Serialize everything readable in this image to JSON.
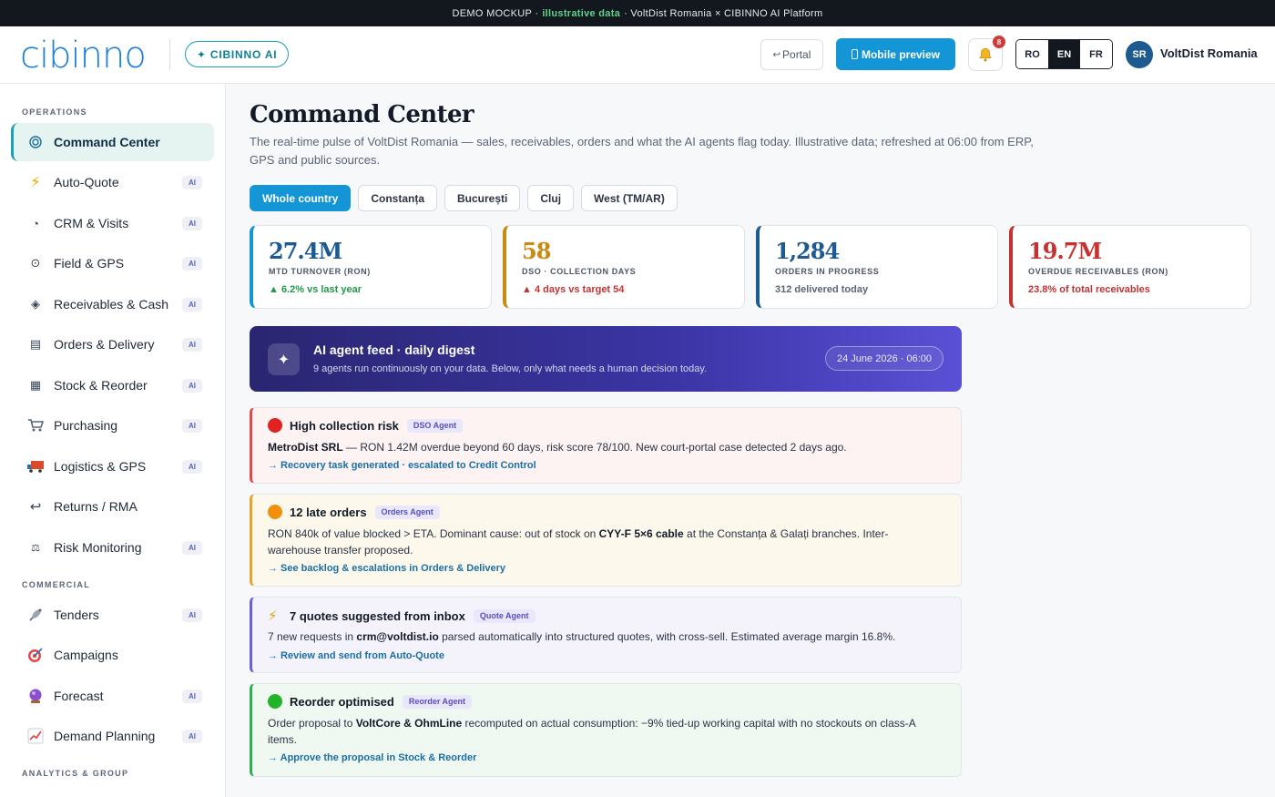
{
  "banner": {
    "prefix": "DEMO MOCKUP ·",
    "highlight": "illustrative data",
    "suffix": "· VoltDist Romania × CIBINNO AI Platform"
  },
  "header": {
    "logo": "cibinno",
    "ai_pill": "CIBINNO AI",
    "portal_label": "Portal",
    "mobile_label": "Mobile preview",
    "notifications": "8",
    "languages": [
      "RO",
      "EN",
      "FR"
    ],
    "active_language": "EN",
    "avatar": "SR",
    "company": "VoltDist Romania"
  },
  "sidebar": {
    "sections": {
      "operations": "OPERATIONS",
      "commercial": "COMMERCIAL",
      "analytics": "ANALYTICS & GROUP"
    },
    "ai_tag": "AI",
    "items": [
      {
        "label": "Command Center",
        "icon": "target-icon",
        "ai": false,
        "active": true
      },
      {
        "label": "Auto-Quote",
        "icon": "lightning-icon",
        "ai": true
      },
      {
        "label": "CRM & Visits",
        "icon": "pie-icon",
        "ai": true
      },
      {
        "label": "Field & GPS",
        "icon": "location-icon",
        "ai": true
      },
      {
        "label": "Receivables & Cash",
        "icon": "diamond-icon",
        "ai": true
      },
      {
        "label": "Orders & Delivery",
        "icon": "list-icon",
        "ai": true
      },
      {
        "label": "Stock & Reorder",
        "icon": "grid-icon",
        "ai": true
      },
      {
        "label": "Purchasing",
        "icon": "cart-icon",
        "ai": true
      },
      {
        "label": "Logistics & GPS",
        "icon": "truck-icon",
        "ai": true
      },
      {
        "label": "Returns / RMA",
        "icon": "return-icon",
        "ai": false
      },
      {
        "label": "Risk Monitoring",
        "icon": "scale-icon",
        "ai": true
      },
      {
        "label": "Tenders",
        "icon": "satellite-icon",
        "ai": true
      },
      {
        "label": "Campaigns",
        "icon": "target-dart-icon",
        "ai": false
      },
      {
        "label": "Forecast",
        "icon": "crystal-ball-icon",
        "ai": true
      },
      {
        "label": "Demand Planning",
        "icon": "chart-icon",
        "ai": true
      }
    ]
  },
  "main": {
    "title": "Command Center",
    "subtitle": "The real-time pulse of VoltDist Romania — sales, receivables, orders and what the AI agents flag today. Illustrative data; refreshed at 06:00 from ERP, GPS and public sources.",
    "regions": [
      "Whole country",
      "Constanța",
      "București",
      "Cluj",
      "West (TM/AR)"
    ],
    "active_region": "Whole country",
    "kpis": [
      {
        "value": "27.4M",
        "label": "MTD TURNOVER (RON)",
        "note": "▲ 6.2% vs last year",
        "color": "#1495d5",
        "note_color": "#1f9a48"
      },
      {
        "value": "58",
        "label": "DSO · COLLECTION DAYS",
        "note": "▲ 4 days vs target 54",
        "color": "#c98a12",
        "note_color": "#c63131"
      },
      {
        "value": "1,284",
        "label": "ORDERS IN PROGRESS",
        "note": "312 delivered today",
        "color": "#1c5a8f",
        "note_color": "#5b6577"
      },
      {
        "value": "19.7M",
        "label": "OVERDUE RECEIVABLES (RON)",
        "note": "23.8% of total receivables",
        "color": "#c63131",
        "note_color": "#c63131"
      }
    ],
    "digest": {
      "title": "AI agent feed · daily digest",
      "subtitle": "9 agents run continuously on your data. Below, only what needs a human decision today.",
      "date": "24 June 2026 · 06:00"
    },
    "cards": [
      {
        "title": "High collection risk",
        "agent": "DSO Agent",
        "bold_lead": "MetroDist SRL",
        "body": " — RON 1.42M overdue beyond 60 days, risk score 78/100. New court-portal case detected 2 days ago.",
        "link": "→ Recovery task generated · escalated to Credit Control",
        "accent": "#e04a4a",
        "bg": "#fdf3f3"
      },
      {
        "title": "12 late orders",
        "agent": "Orders Agent",
        "body_pre": "RON 840k of value blocked > ETA. Dominant cause: out of stock on ",
        "body_bold": "CYY-F 5×6 cable",
        "body_post": " at the Constanța & Galați branches. Inter-warehouse transfer proposed.",
        "link": "→ See backlog & escalations in Orders & Delivery",
        "accent": "#e6a42a",
        "bg": "#fcf8ec"
      },
      {
        "title": "7 quotes suggested from inbox",
        "agent": "Quote Agent",
        "body_pre": "7 new requests in ",
        "body_bold": "crm@voltdist.io",
        "body_post": " parsed automatically into structured quotes, with cross-sell. Estimated average margin 16.8%.",
        "link": "→ Review and send from Auto-Quote",
        "accent": "#6a5fd4",
        "bg": "#f4f3fc"
      },
      {
        "title": "Reorder optimised",
        "agent": "Reorder Agent",
        "body_pre": "Order proposal to ",
        "body_bold": "VoltCore & OhmLine",
        "body_post": " recomputed on actual consumption: −9% tied-up working capital with no stockouts on class-A items.",
        "link": "→ Approve the proposal in Stock & Reorder",
        "accent": "#2fae55",
        "bg": "#eff8f1"
      }
    ]
  }
}
